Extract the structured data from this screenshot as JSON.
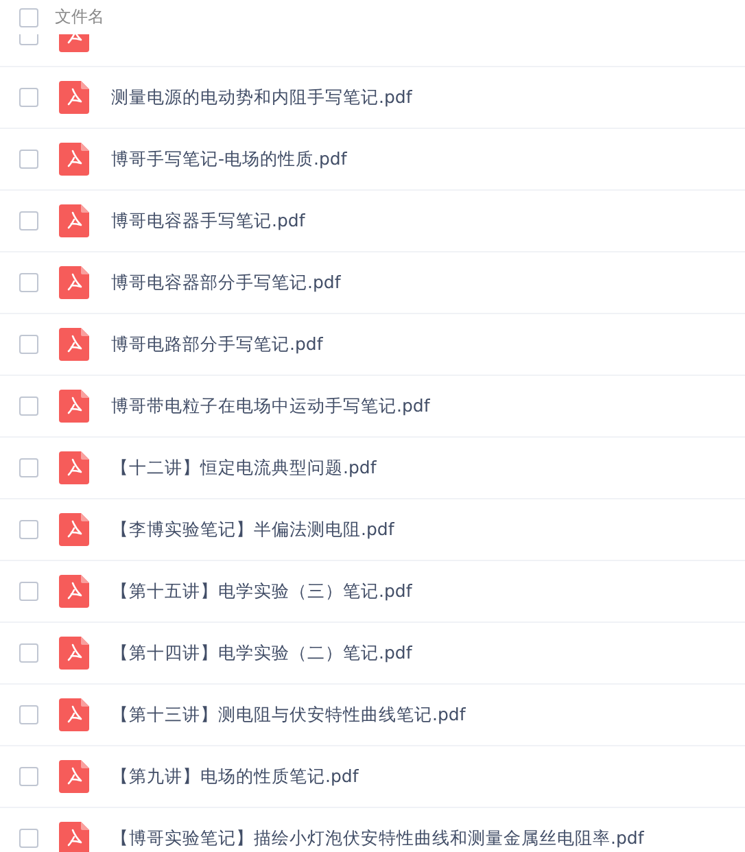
{
  "header": {
    "checked": false,
    "label": "文件名"
  },
  "files": [
    {
      "checked": false,
      "partial": true
    },
    {
      "name": "测量电源的电动势和内阻手写笔记.pdf",
      "checked": false
    },
    {
      "name": "博哥手写笔记-电场的性质.pdf",
      "checked": false
    },
    {
      "name": "博哥电容器手写笔记.pdf",
      "checked": false
    },
    {
      "name": "博哥电容器部分手写笔记.pdf",
      "checked": false
    },
    {
      "name": "博哥电路部分手写笔记.pdf",
      "checked": false
    },
    {
      "name": "博哥带电粒子在电场中运动手写笔记.pdf",
      "checked": false
    },
    {
      "name": "【十二讲】恒定电流典型问题.pdf",
      "checked": false
    },
    {
      "name": "【李博实验笔记】半偏法测电阻.pdf",
      "checked": false
    },
    {
      "name": "【第十五讲】电学实验（三）笔记.pdf",
      "checked": false
    },
    {
      "name": "【第十四讲】电学实验（二）笔记.pdf",
      "checked": false
    },
    {
      "name": "【第十三讲】测电阻与伏安特性曲线笔记.pdf",
      "checked": false
    },
    {
      "name": "【第九讲】电场的性质笔记.pdf",
      "checked": false
    },
    {
      "name": "【博哥实验笔记】描绘小灯泡伏安特性曲线和测量金属丝电阻率.pdf",
      "checked": false
    }
  ]
}
